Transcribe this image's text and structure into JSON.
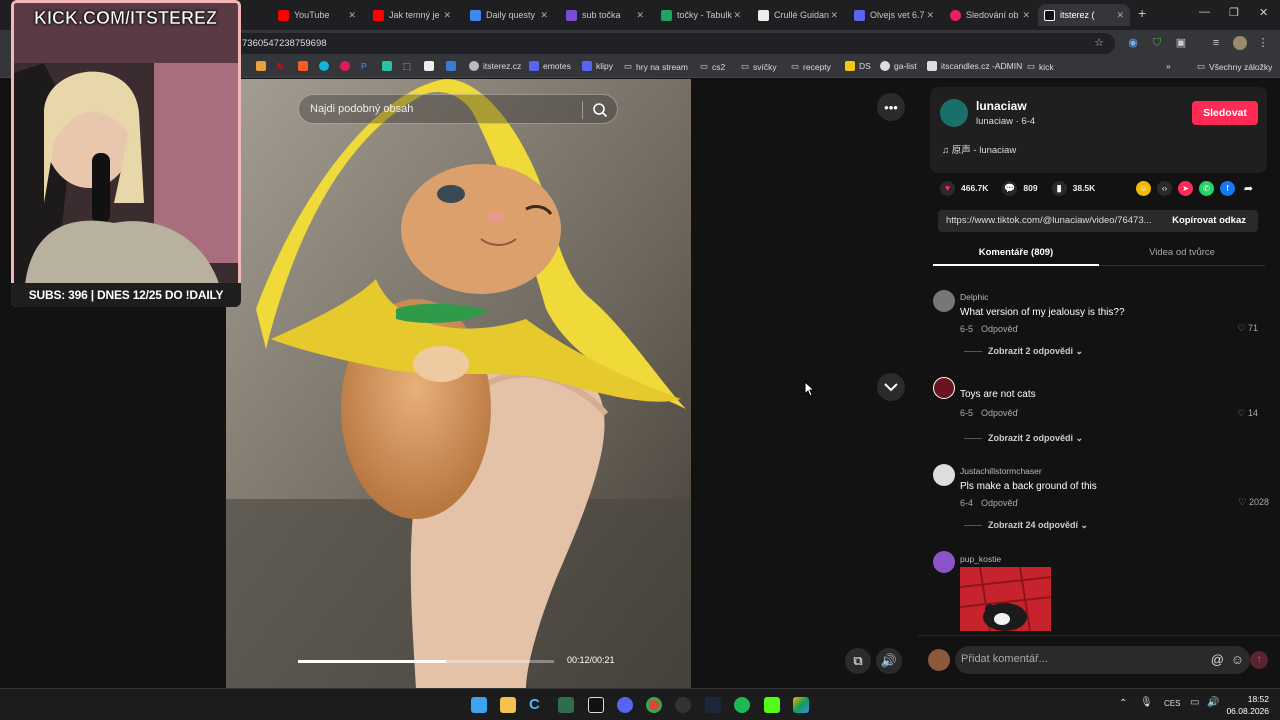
{
  "browser": {
    "tabs": [
      {
        "label": "YouTube",
        "color": "#ff0000"
      },
      {
        "label": "Jak temný je",
        "color": "#ff0000"
      },
      {
        "label": "Daily questy",
        "color": "#4285f4"
      },
      {
        "label": "sub točka",
        "color": "#7b4bd8"
      },
      {
        "label": "točky - Tabulk",
        "color": "#1fa463"
      },
      {
        "label": "Crullé Guidan",
        "color": "#111111"
      },
      {
        "label": "Olvejs vet 6.7",
        "color": "#5865f2"
      },
      {
        "label": "Sledování ob",
        "color": "#e91e63"
      },
      {
        "label": "itsterez (",
        "color": "#111111"
      }
    ],
    "new_tab_symbol": "+",
    "url": "7360547238759698",
    "bookmarks": [
      {
        "label": "itsterez.cz",
        "color": "#bbbbbb"
      },
      {
        "label": "emotes",
        "color": "#5865f2"
      },
      {
        "label": "klipy",
        "color": "#5865f2"
      },
      {
        "label": "hry na stream",
        "color": "#888888"
      },
      {
        "label": "cs2",
        "color": "#888888"
      },
      {
        "label": "svíčky",
        "color": "#888888"
      },
      {
        "label": "recepty",
        "color": "#888888"
      },
      {
        "label": "DS",
        "color": "#f5c518"
      },
      {
        "label": "ga-list",
        "color": "#dddddd"
      },
      {
        "label": "itscandles.cz -ADMIN",
        "color": "#dddddd"
      },
      {
        "label": "kick",
        "color": "#888888"
      }
    ],
    "all_bookmarks": "Všechny záložky"
  },
  "video": {
    "search_placeholder": "Najdi podobný obsah",
    "time": "00:12/00:21",
    "progress": 0.58
  },
  "creator": {
    "name": "lunaciaw",
    "sub": "lunaciaw · 6-4",
    "follow": "Sledovat",
    "music": "原声 - lunaciaw"
  },
  "stats": {
    "likes": "466.7K",
    "comments": "809",
    "saves": "38.5K"
  },
  "link": {
    "url": "https://www.tiktok.com/@lunaciaw/video/76473...",
    "copy": "Kopírovat odkaz"
  },
  "comment_tabs": {
    "comments": "Komentáře (809)",
    "videos": "Videa od tvůrce"
  },
  "comments": [
    {
      "name": "Delphic",
      "text": "What version of my jealousy is this??",
      "date": "6-5",
      "reply": "Odpověď",
      "likes": "71",
      "more": "Zobrazit 2 odpovědi"
    },
    {
      "name": "",
      "text": "Toys are not cats",
      "date": "6-5",
      "reply": "Odpověď",
      "likes": "14",
      "more": "Zobrazit 2 odpovědi"
    },
    {
      "name": "Justachillstormchaser",
      "text": "Pls make a back ground of this",
      "date": "6-4",
      "reply": "Odpověď",
      "likes": "2028",
      "more": "Zobrazit 24 odpovědí"
    },
    {
      "name": "pup_kostie"
    }
  ],
  "add_comment": {
    "placeholder": "Přidat komentář..."
  },
  "overlay": {
    "kick": "KICK.COM/ITSTEREZ",
    "subs": "SUBS: 396 | DNES 12/25 DO !DAILY"
  },
  "taskbar": {
    "lang": "CES",
    "time": "18:52",
    "date": "06.08.2026"
  },
  "colors": {
    "accent": "#fe2c55",
    "like": "#fe2c55",
    "overlay_border": "#f4b7b7"
  }
}
